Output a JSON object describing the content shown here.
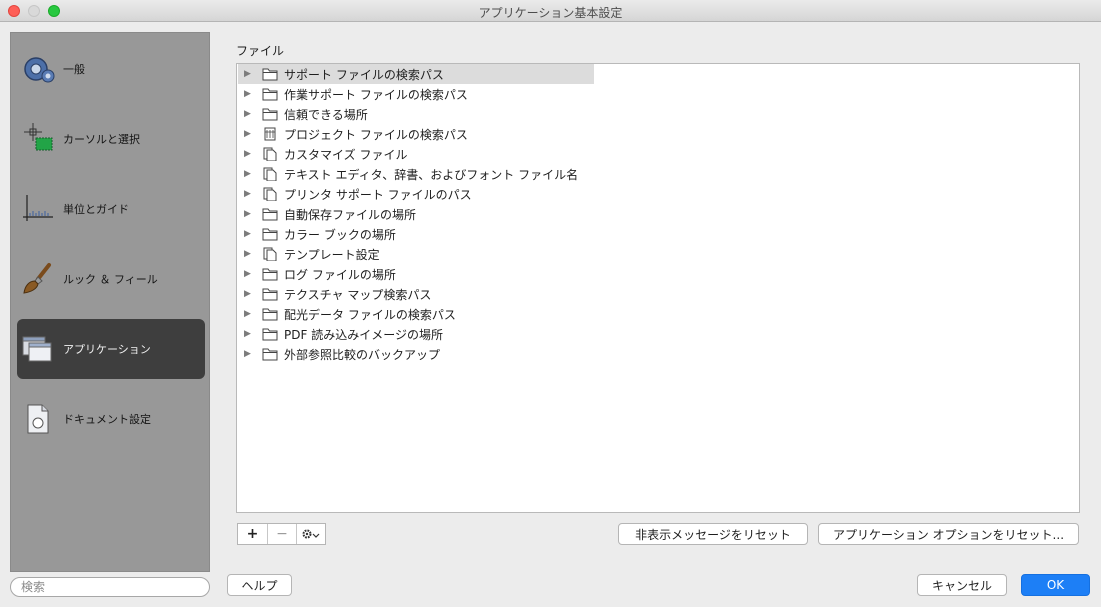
{
  "window": {
    "title": "アプリケーション基本設定"
  },
  "sidebar": {
    "items": [
      {
        "label": "一般",
        "icon": "gear-icon"
      },
      {
        "label": "カーソルと選択",
        "icon": "cursor-selection-icon"
      },
      {
        "label": "単位とガイド",
        "icon": "units-guides-icon"
      },
      {
        "label": "ルック ＆ フィール",
        "icon": "brush-icon"
      },
      {
        "label": "アプリケーション",
        "icon": "windows-icon"
      },
      {
        "label": "ドキュメント設定",
        "icon": "document-icon"
      }
    ],
    "active_index": 4
  },
  "search": {
    "placeholder": "検索"
  },
  "files_section": {
    "title": "ファイル",
    "items": [
      {
        "label": "サポート ファイルの検索パス",
        "icon": "folder-icon"
      },
      {
        "label": "作業サポート ファイルの検索パス",
        "icon": "folder-icon"
      },
      {
        "label": "信頼できる場所",
        "icon": "folder-icon"
      },
      {
        "label": "プロジェクト ファイルの検索パス",
        "icon": "project-icon"
      },
      {
        "label": "カスタマイズ ファイル",
        "icon": "document-icon"
      },
      {
        "label": "テキスト エディタ、辞書、およびフォント ファイル名",
        "icon": "document-icon"
      },
      {
        "label": "プリンタ サポート ファイルのパス",
        "icon": "document-icon"
      },
      {
        "label": "自動保存ファイルの場所",
        "icon": "folder-icon"
      },
      {
        "label": "カラー ブックの場所",
        "icon": "folder-icon"
      },
      {
        "label": "テンプレート設定",
        "icon": "document-icon"
      },
      {
        "label": "ログ ファイルの場所",
        "icon": "folder-icon"
      },
      {
        "label": "テクスチャ マップ検索パス",
        "icon": "folder-icon"
      },
      {
        "label": "配光データ ファイルの検索パス",
        "icon": "folder-icon"
      },
      {
        "label": "PDF 読み込みイメージの場所",
        "icon": "folder-icon"
      },
      {
        "label": "外部参照比較のバックアップ",
        "icon": "folder-icon"
      }
    ],
    "selected_index": 0
  },
  "toolbar": {
    "add_label": "+",
    "remove_label": "−",
    "reset_messages_label": "非表示メッセージをリセット",
    "reset_options_label": "アプリケーション オプションをリセット..."
  },
  "footer": {
    "help_label": "ヘルプ",
    "cancel_label": "キャンセル",
    "ok_label": "OK"
  }
}
